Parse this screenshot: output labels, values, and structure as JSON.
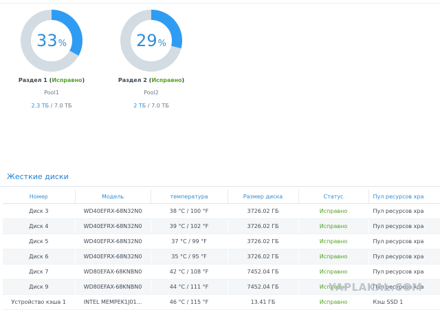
{
  "volumes": [
    {
      "percent": "33",
      "percent_sign": "%",
      "percent_value": 33,
      "label": "Раздел 1",
      "status": "Исправно",
      "pool": "Pool1",
      "used": "2.3 ТБ",
      "separator": " / ",
      "total": "7.0 ТБ"
    },
    {
      "percent": "29",
      "percent_sign": "%",
      "percent_value": 29,
      "label": "Раздел 2",
      "status": "Исправно",
      "pool": "Pool2",
      "used": "2 ТБ",
      "separator": " / ",
      "total": "7.0 ТБ"
    }
  ],
  "disks_section": {
    "title": "Жесткие диски",
    "columns": [
      "Номер",
      "Модель",
      "температура",
      "Размер диска",
      "Статус",
      "Пул ресурсов хра"
    ],
    "rows": [
      {
        "number": "Диск 3",
        "model": "WD40EFRX-68N32N0",
        "temp": "38 °C / 100 °F",
        "size": "3726.02 ГБ",
        "status": "Исправно",
        "pool": "Пул ресурсов хра"
      },
      {
        "number": "Диск 4",
        "model": "WD40EFRX-68N32N0",
        "temp": "39 °C / 102 °F",
        "size": "3726.02 ГБ",
        "status": "Исправно",
        "pool": "Пул ресурсов хра"
      },
      {
        "number": "Диск 5",
        "model": "WD40EFRX-68N32N0",
        "temp": "37 °C / 99 °F",
        "size": "3726.02 ГБ",
        "status": "Исправно",
        "pool": "Пул ресурсов хра"
      },
      {
        "number": "Диск 6",
        "model": "WD40EFRX-68N32N0",
        "temp": "35 °C / 95 °F",
        "size": "3726.02 ГБ",
        "status": "Исправно",
        "pool": "Пул ресурсов хра"
      },
      {
        "number": "Диск 7",
        "model": "WD80EFAX-68KNBN0",
        "temp": "42 °C / 108 °F",
        "size": "7452.04 ГБ",
        "status": "Исправно",
        "pool": "Пул ресурсов хра"
      },
      {
        "number": "Диск 9",
        "model": "WD80EFAX-68KNBN0",
        "temp": "44 °C / 111 °F",
        "size": "7452.04 ГБ",
        "status": "Исправно",
        "pool": "Пул ресурсов хра"
      },
      {
        "number": "Устройство кэша 1",
        "model": "INTEL MEMPEK1J01...",
        "temp": "46 °C / 115 °F",
        "size": "13.41 ГБ",
        "status": "Исправно",
        "pool": "Кэш SSD 1"
      }
    ]
  },
  "watermark": "YAPLAKAL.COM",
  "colors": {
    "accent": "#2f8ed8",
    "ring_track": "#d3dbe3",
    "ok": "#54a121"
  }
}
